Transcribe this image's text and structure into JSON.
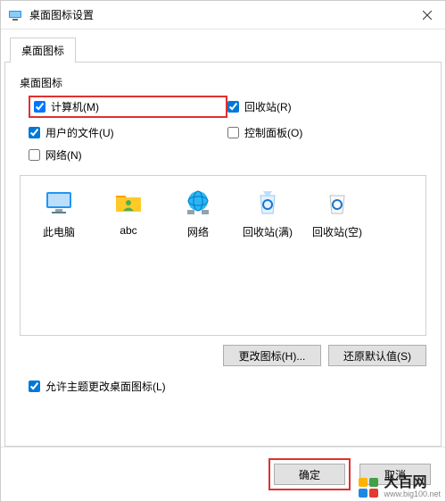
{
  "window": {
    "title": "桌面图标设置"
  },
  "tab": {
    "label": "桌面图标"
  },
  "group": {
    "label": "桌面图标"
  },
  "checks": {
    "computer": {
      "label": "计算机(M)",
      "checked": true
    },
    "recycle": {
      "label": "回收站(R)",
      "checked": true
    },
    "userfiles": {
      "label": "用户的文件(U)",
      "checked": true
    },
    "control": {
      "label": "控制面板(O)",
      "checked": false
    },
    "network": {
      "label": "网络(N)",
      "checked": false
    }
  },
  "icons": {
    "thispc": "此电脑",
    "user": "abc",
    "network": "网络",
    "recyclefull": "回收站(满)",
    "recycleempty": "回收站(空)"
  },
  "buttons": {
    "changeicon": "更改图标(H)...",
    "restore": "还原默认值(S)",
    "ok": "确定",
    "cancel": "取消"
  },
  "allowtheme": {
    "label": "允许主题更改桌面图标(L)",
    "checked": true
  },
  "watermark": {
    "name": "大百网",
    "url": "www.big100.net"
  }
}
